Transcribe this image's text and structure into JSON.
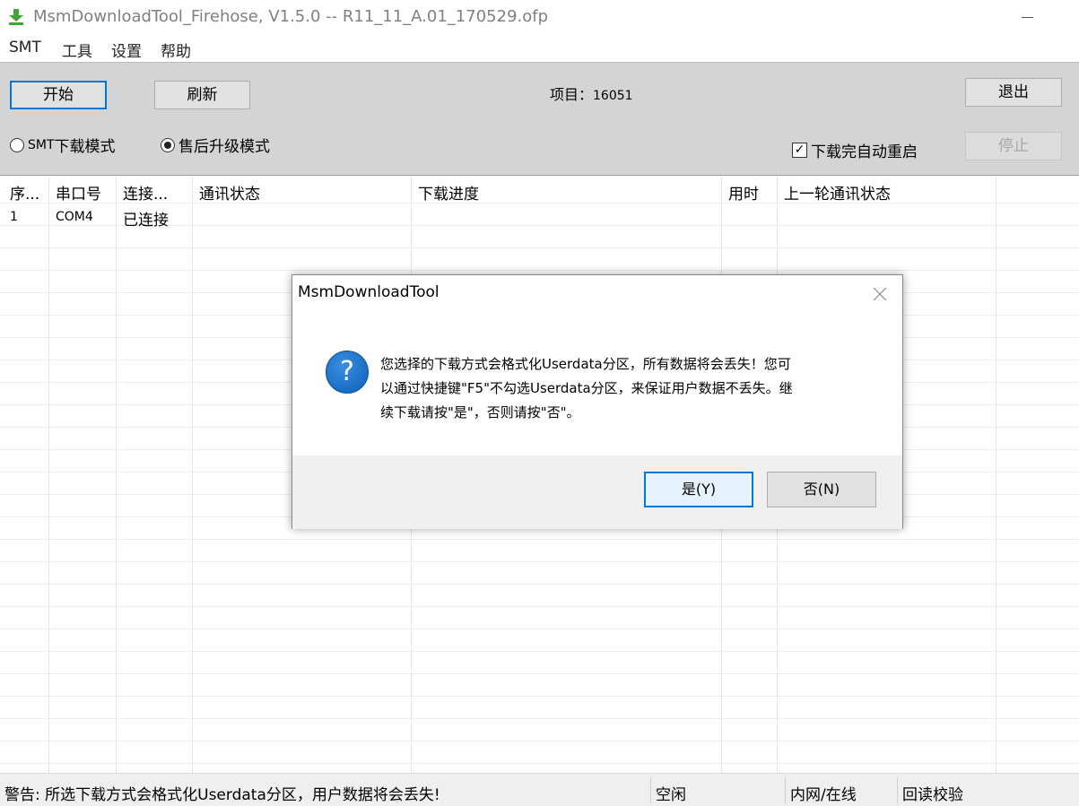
{
  "window": {
    "title": "MsmDownloadTool_Firehose, V1.5.0 -- R11_11_A.01_170529.ofp",
    "minimize_symbol": "—"
  },
  "menu": {
    "items": [
      "SMT",
      "工具",
      "设置",
      "帮助"
    ]
  },
  "toolbar": {
    "start_label": "开始",
    "refresh_label": "刷新",
    "project_label": "项目：",
    "project_value": "16051",
    "exit_label": "退出",
    "stop_label": "停止",
    "mode_smt_prefix": "SMT",
    "mode_smt_label": "下载模式",
    "mode_aftersales_label": "售后升级模式",
    "selected_mode": "aftersales",
    "auto_reboot_label": "下载完自动重启",
    "auto_reboot_checked": true
  },
  "table": {
    "columns": [
      "序...",
      "串口号",
      "连接...",
      "通讯状态",
      "下载进度",
      "用时",
      "上一轮通讯状态"
    ],
    "rows": [
      {
        "index": "1",
        "port": "COM4",
        "connection": "已连接",
        "comm_status": "",
        "progress": "",
        "time": "",
        "last_status": ""
      }
    ]
  },
  "statusbar": {
    "warning": "警告: 所选下载方式会格式化Userdata分区，用户数据将会丢失!",
    "state": "空闲",
    "network": "内网/在线",
    "verify": "回读校验"
  },
  "dialog": {
    "title": "MsmDownloadTool",
    "message_line1": "您选择的下载方式会格式化Userdata分区，所有数据将会丢失！您可",
    "message_line2": "以通过快捷键\"F5\"不勾选Userdata分区，来保证用户数据不丢失。继",
    "message_line3": "续下载请按\"是\"，否则请按\"否\"。",
    "icon_glyph": "?",
    "yes_label": "是(Y)",
    "no_label": "否(N)"
  },
  "colors": {
    "accent": "#0078d7",
    "toolbar_bg": "#d4d4d4",
    "question_icon": "#1565c0",
    "app_icon": "#3fa535"
  }
}
